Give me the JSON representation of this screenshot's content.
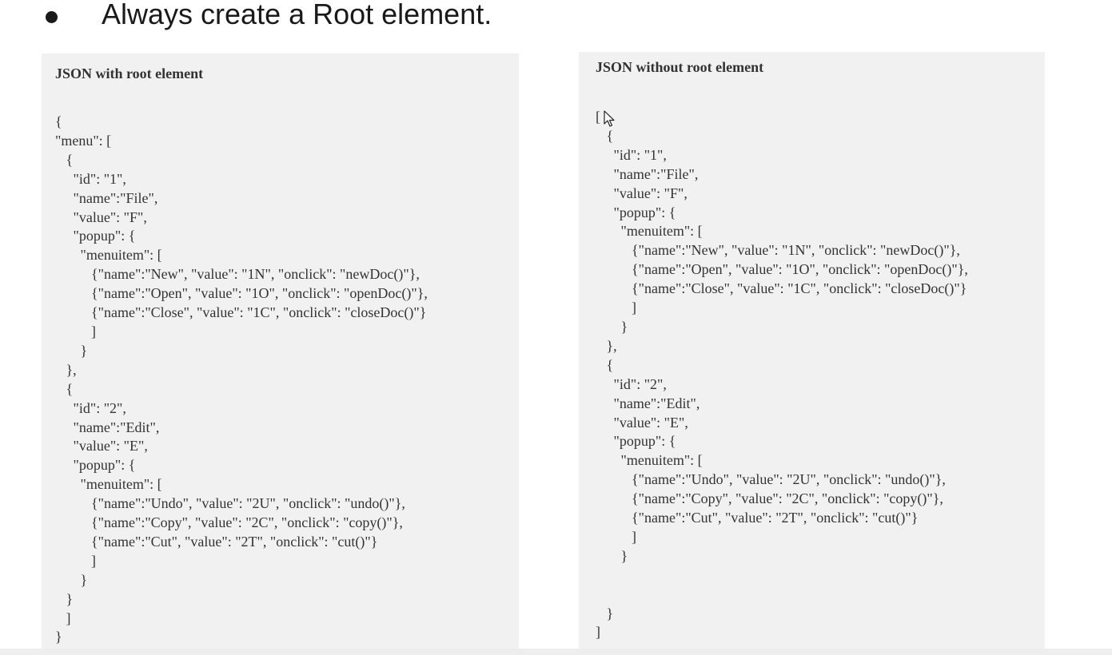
{
  "bullet": {
    "text": "Always create a Root element."
  },
  "left_panel": {
    "title": "JSON with root element",
    "code": "{\n\"menu\": [\n   {\n     \"id\": \"1\",\n     \"name\":\"File\",\n     \"value\": \"F\",\n     \"popup\": {\n       \"menuitem\": [\n          {\"name\":\"New\", \"value\": \"1N\", \"onclick\": \"newDoc()\"},\n          {\"name\":\"Open\", \"value\": \"1O\", \"onclick\": \"openDoc()\"},\n          {\"name\":\"Close\", \"value\": \"1C\", \"onclick\": \"closeDoc()\"}\n          ]\n       }\n   },\n   {\n     \"id\": \"2\",\n     \"name\":\"Edit\",\n     \"value\": \"E\",\n     \"popup\": {\n       \"menuitem\": [\n          {\"name\":\"Undo\", \"value\": \"2U\", \"onclick\": \"undo()\"},\n          {\"name\":\"Copy\", \"value\": \"2C\", \"onclick\": \"copy()\"},\n          {\"name\":\"Cut\", \"value\": \"2T\", \"onclick\": \"cut()\"}\n          ]\n       }\n   }\n   ]\n}"
  },
  "right_panel": {
    "title": "JSON without root element",
    "code": "[\n   {\n     \"id\": \"1\",\n     \"name\":\"File\",\n     \"value\": \"F\",\n     \"popup\": {\n       \"menuitem\": [\n          {\"name\":\"New\", \"value\": \"1N\", \"onclick\": \"newDoc()\"},\n          {\"name\":\"Open\", \"value\": \"1O\", \"onclick\": \"openDoc()\"},\n          {\"name\":\"Close\", \"value\": \"1C\", \"onclick\": \"closeDoc()\"}\n          ]\n       }\n   },\n   {\n     \"id\": \"2\",\n     \"name\":\"Edit\",\n     \"value\": \"E\",\n     \"popup\": {\n       \"menuitem\": [\n          {\"name\":\"Undo\", \"value\": \"2U\", \"onclick\": \"undo()\"},\n          {\"name\":\"Copy\", \"value\": \"2C\", \"onclick\": \"copy()\"},\n          {\"name\":\"Cut\", \"value\": \"2T\", \"onclick\": \"cut()\"}\n          ]\n       }\n\n\n   }\n]"
  },
  "icons": {
    "cursor": "mouse-pointer-icon"
  },
  "colors": {
    "panel_background": "#f1f1f1",
    "code_text": "#333333",
    "heading_text": "#1a1a1a"
  }
}
